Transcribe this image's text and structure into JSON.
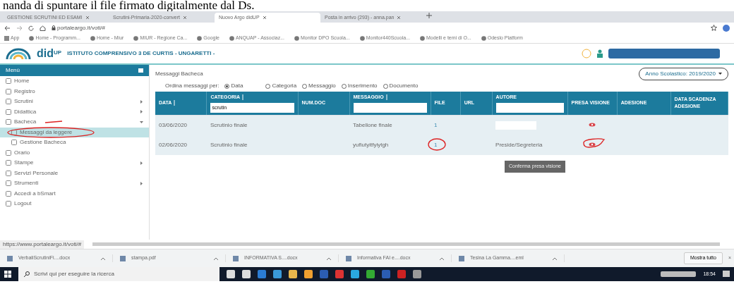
{
  "document_text": "nanda di spuntare il file firmato digitalmente dal Ds.",
  "browser": {
    "tabs": [
      {
        "label": "GESTIONE SCRUTINI ED ESAMI",
        "selected": false
      },
      {
        "label": "Scrutini-Primaria-2020-convert",
        "selected": false
      },
      {
        "label": "Nuovo Argo didUP",
        "selected": true
      },
      {
        "label": "Posta in arrivo (293) - anna.pan",
        "selected": false
      }
    ],
    "address": "portaleargo.it/voti/#",
    "bookmarks": [
      "App",
      "Home - Programm...",
      "Home - Miur",
      "MIUR - Regione Ca...",
      "Google",
      "ANQUAP - Associaz...",
      "Monitor DPO Scuola...",
      "Monitor440Scuola...",
      "Modelli e temi di O...",
      "Odeslo Platform"
    ]
  },
  "app": {
    "logo": "did",
    "logo_sup": "UP",
    "school": "ISTITUTO COMPRENSIVO 3 DE CURTIS - UNGARETTI -"
  },
  "sidebar": {
    "title": "Menù",
    "items": [
      {
        "label": "Home"
      },
      {
        "label": "Registro"
      },
      {
        "label": "Scrutini",
        "expanded": false
      },
      {
        "label": "Didattica",
        "expanded": false
      },
      {
        "label": "Bacheca",
        "expanded": true,
        "annotated": true,
        "children": [
          {
            "label": "Messaggi da leggere",
            "selected": true,
            "annotated": true
          },
          {
            "label": "Gestione Bacheca",
            "selected": false,
            "annotated": false
          }
        ]
      },
      {
        "label": "Orario"
      },
      {
        "label": "Stampe",
        "expanded": false
      },
      {
        "label": "Servizi Personale"
      },
      {
        "label": "Strumenti",
        "expanded": false
      },
      {
        "label": "Accedi a bSmart"
      },
      {
        "label": "Logout"
      }
    ]
  },
  "page": {
    "title": "Messaggi Bacheca",
    "year": "Anno Scolastico: 2019/2020",
    "sort_label": "Ordina messaggi per:",
    "sort_options": [
      {
        "label": "Data",
        "selected": true
      },
      {
        "label": "Categoria",
        "selected": false
      },
      {
        "label": "Messaggio",
        "selected": false
      },
      {
        "label": "Inserimento",
        "selected": false
      },
      {
        "label": "Documento",
        "selected": false
      }
    ]
  },
  "table": {
    "columns": [
      {
        "label": "DATA",
        "sortable": true
      },
      {
        "label": "CATEGORIA",
        "sortable": true,
        "has_filter": true,
        "filter": "scrutin"
      },
      {
        "label": "NUM.DOC",
        "sortable": false
      },
      {
        "label": "MESSAGGIO",
        "sortable": true,
        "has_filter": true
      },
      {
        "label": "FILE",
        "sortable": false
      },
      {
        "label": "URL",
        "sortable": false
      },
      {
        "label": "AUTORE",
        "sortable": false,
        "has_filter": true
      },
      {
        "label": "PRESA VISIONE",
        "sortable": false
      },
      {
        "label": "ADESIONE",
        "sortable": false
      },
      {
        "label": "DATA SCADENZA ADESIONE",
        "sortable": false
      }
    ],
    "rows": [
      {
        "date": "03/06/2020",
        "category": "Scrutinio finale",
        "message": "Tabellone finale",
        "file": "1",
        "author": "",
        "annotated": false
      },
      {
        "date": "02/06/2020",
        "category": "Scrutinio finale",
        "message": "yufiutyitfyiytgh",
        "file": "1",
        "author": "Preside/Segreteria",
        "annotated": true
      }
    ],
    "tooltip": "Conferma presa visione"
  },
  "status_url": "https://www.portaleargo.it/voti/#",
  "downloads": {
    "items": [
      "VerbaliScrutiniFi....docx",
      "stampa.pdf",
      "INFORMATIVA S....docx",
      "Informativa FAI e....docx",
      "Tesina La Gamma....eml"
    ],
    "show_all": "Mostra tutto",
    "close": "×"
  },
  "taskbar": {
    "search_placeholder": "Scrivi qui per eseguire la ricerca",
    "clock": "18:54"
  }
}
